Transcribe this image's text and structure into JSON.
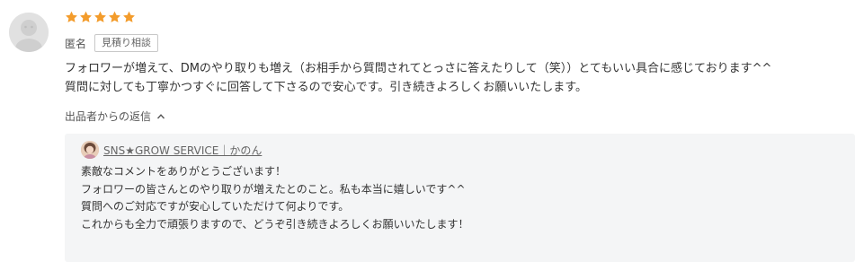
{
  "review": {
    "rating": 5,
    "star_color": "#f39c2c",
    "avatar_icon": "anonymous-user-icon",
    "reviewer_name": "匿名",
    "tag_label": "見積り相談",
    "text_lines": [
      "フォロワーが増えて、DMのやり取りも増え（お相手から質問されてとっさに答えたりして（笑））とてもいい具合に感じております^^",
      "質問に対しても丁寧かつすぐに回答して下さるので安心です。引き続きよろしくお願いいたします。"
    ]
  },
  "seller_reply": {
    "toggle_label": "出品者からの返信",
    "toggle_icon": "chevron-up-icon",
    "seller_name": "SNS★GROW SERVICE｜かのん",
    "reply_lines": [
      "素敵なコメントをありがとうございます！",
      "フォロワーの皆さんとのやり取りが増えたとのこと。私も本当に嬉しいです^^",
      "質問へのご対応ですが安心していただけて何よりです。",
      "これからも全力で頑張りますので、どうぞ引き続きよろしくお願いいたします！"
    ]
  }
}
